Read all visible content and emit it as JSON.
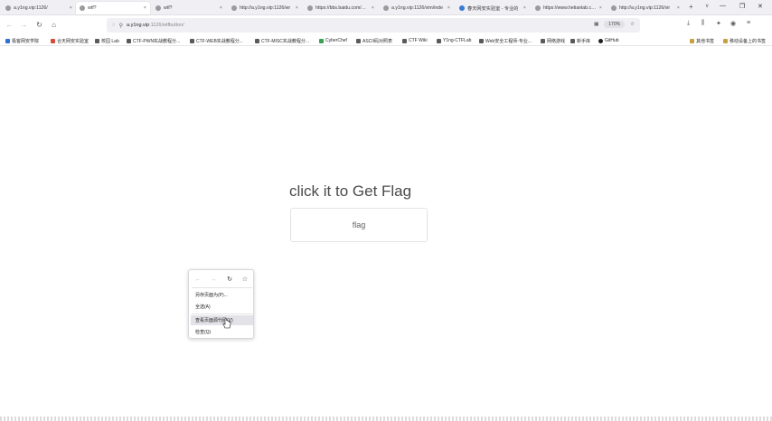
{
  "tabs": [
    {
      "title": "a.y1ng.vip:1126/",
      "active": false,
      "favicon_color": "#9a9a9a"
    },
    {
      "title": "wtf?",
      "active": true,
      "favicon_color": "#9a9a9a"
    },
    {
      "title": "wtf?",
      "active": false,
      "favicon_color": "#9a9a9a"
    },
    {
      "title": "http://a.y1ng.vip:1126/wr",
      "active": false,
      "favicon_color": "#9a9a9a"
    },
    {
      "title": "https://bbs.baidu.com/bos",
      "active": false,
      "favicon_color": "#9a9a9a"
    },
    {
      "title": "a.y1ng.vip:1126/vim/inde",
      "active": false,
      "favicon_color": "#9a9a9a"
    },
    {
      "title": "春天网安实验室 - 专业的",
      "active": false,
      "favicon_color": "#3a7bd5"
    },
    {
      "title": "https://www.hetianlab.com",
      "active": false,
      "favicon_color": "#9a9a9a"
    },
    {
      "title": "http://a.y1ng.vip:1126/vir",
      "active": false,
      "favicon_color": "#9a9a9a"
    }
  ],
  "tabstrip": {
    "close_glyph": "×",
    "new_tab_glyph": "+",
    "overflow_glyph": "∨"
  },
  "window_controls": {
    "minimize": "—",
    "maximize": "❐",
    "close": "✕"
  },
  "nav": {
    "back": "←",
    "forward": "→",
    "reload": "↻",
    "home": "⌂"
  },
  "url": {
    "host": "a.y1ng.vip",
    "path": ":1126/wtfbutton/",
    "shield_glyph": "◌",
    "lock_glyph": "⚲",
    "zoom": "170%",
    "page_action_glyph": "▦",
    "star_glyph": "☆"
  },
  "toolbar": {
    "download": "⤓",
    "library": "⫼",
    "extension": "✦",
    "account": "◉",
    "menu": "≡"
  },
  "bookmarks": [
    {
      "label": "极客网安学院",
      "color": "#2f6fd6"
    },
    {
      "label": "合天网安实验室",
      "color": "#d64b3a"
    },
    {
      "label": "校园 Lab",
      "color": "#5a5a5a"
    },
    {
      "label": "CTF-PWN实战教程分...",
      "color": "#5a5a5a"
    },
    {
      "label": "CTF-WEB实战教程分...",
      "color": "#5a5a5a"
    },
    {
      "label": "CTF-MISC实战教程分...",
      "color": "#5a5a5a"
    },
    {
      "label": "CyberChef",
      "color": "#3aa055"
    },
    {
      "label": "ASCII码对照表",
      "color": "#5a5a5a"
    },
    {
      "label": "CTF Wiki",
      "color": "#5a5a5a"
    },
    {
      "label": "Y1ng-CTFLab",
      "color": "#5a5a5a"
    },
    {
      "label": "Web安全工程师-专业...",
      "color": "#5a5a5a"
    },
    {
      "label": "网络游戏",
      "color": "#5a5a5a"
    },
    {
      "label": "新手库",
      "color": "#5a5a5a"
    },
    {
      "label": "GitHub",
      "color": "#222222"
    }
  ],
  "bookmarks_right": [
    {
      "label": "其他书签",
      "color": "#c8a040"
    },
    {
      "label": "移动设备上的书签",
      "color": "#c8a040"
    }
  ],
  "page": {
    "heading": "click it to Get Flag",
    "button_label": "flag"
  },
  "context_menu": {
    "nav": {
      "back": "←",
      "forward": "→",
      "reload": "↻",
      "bookmark": "☆"
    },
    "items": [
      {
        "label": "另存页面为(P)...",
        "hover": false
      },
      {
        "label": "全选(A)",
        "hover": false
      },
      {
        "label": "查看页面源代码(V)",
        "hover": true
      },
      {
        "label": "检查(Q)",
        "hover": false
      }
    ]
  }
}
